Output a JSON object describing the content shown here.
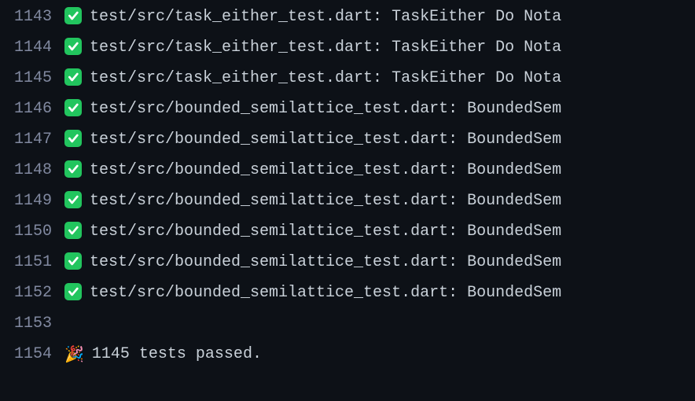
{
  "lines": [
    {
      "number": "1143",
      "icon": "check",
      "text": "test/src/task_either_test.dart: TaskEither Do Nota"
    },
    {
      "number": "1144",
      "icon": "check",
      "text": "test/src/task_either_test.dart: TaskEither Do Nota"
    },
    {
      "number": "1145",
      "icon": "check",
      "text": "test/src/task_either_test.dart: TaskEither Do Nota"
    },
    {
      "number": "1146",
      "icon": "check",
      "text": "test/src/bounded_semilattice_test.dart: BoundedSem"
    },
    {
      "number": "1147",
      "icon": "check",
      "text": "test/src/bounded_semilattice_test.dart: BoundedSem"
    },
    {
      "number": "1148",
      "icon": "check",
      "text": "test/src/bounded_semilattice_test.dart: BoundedSem"
    },
    {
      "number": "1149",
      "icon": "check",
      "text": "test/src/bounded_semilattice_test.dart: BoundedSem"
    },
    {
      "number": "1150",
      "icon": "check",
      "text": "test/src/bounded_semilattice_test.dart: BoundedSem"
    },
    {
      "number": "1151",
      "icon": "check",
      "text": "test/src/bounded_semilattice_test.dart: BoundedSem"
    },
    {
      "number": "1152",
      "icon": "check",
      "text": "test/src/bounded_semilattice_test.dart: BoundedSem"
    },
    {
      "number": "1153",
      "icon": "",
      "text": ""
    },
    {
      "number": "1154",
      "icon": "party",
      "text": "1145 tests passed."
    }
  ]
}
